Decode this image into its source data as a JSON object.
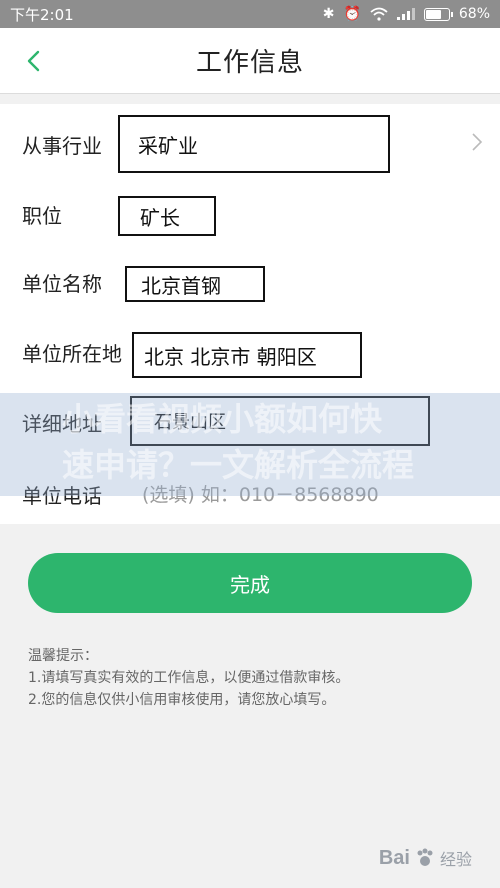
{
  "status_bar": {
    "time": "下午2:01",
    "battery": "68%",
    "icons": [
      "bluetooth-icon",
      "alarm-icon",
      "wifi-icon",
      "signal-icon",
      "battery-icon"
    ]
  },
  "header": {
    "title": "工作信息",
    "back_icon": "chevron-left-icon"
  },
  "form": {
    "industry": {
      "label": "从事行业",
      "value": "采矿业"
    },
    "position": {
      "label": "职位",
      "value": "矿长"
    },
    "company": {
      "label": "单位名称",
      "value": "北京首钢"
    },
    "location": {
      "label": "单位所在地",
      "value": "北京 北京市 朝阳区"
    },
    "address": {
      "label": "详细地址",
      "value": "石景山区"
    },
    "phone": {
      "label": "单位电话",
      "placeholder": "(选填) 如：010－8568890"
    }
  },
  "overlay": {
    "line1": "小看看视频小额如何快",
    "line2": "速申请？一文解析全流程"
  },
  "done_button": {
    "label": "完成"
  },
  "tips": {
    "title": "温馨提示：",
    "line1": "1.请填写真实有效的工作信息，以便通过借款审核。",
    "line2": "2.您的信息仅供小信用审核使用，请您放心填写。"
  },
  "watermark": {
    "brand": "Bai",
    "sub": "经验"
  },
  "colors": {
    "accent": "#2db56d",
    "status_bar": "#8e8e8e"
  }
}
